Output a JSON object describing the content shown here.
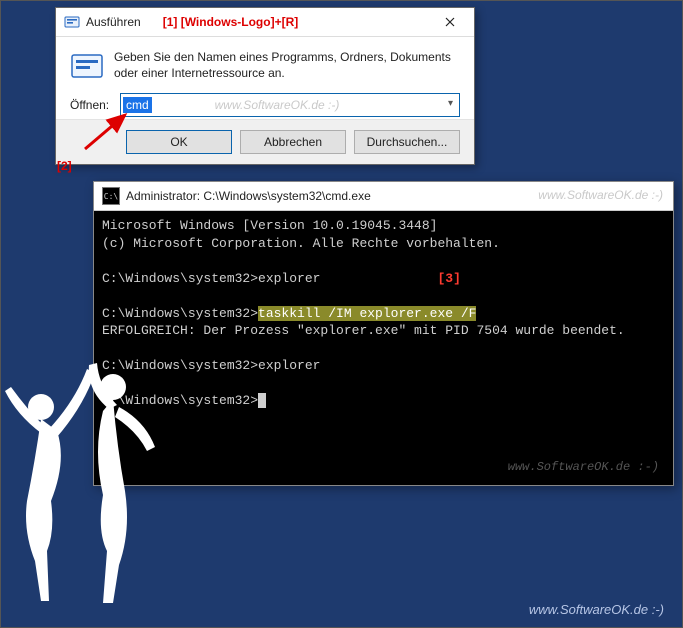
{
  "run": {
    "title": "Ausführen",
    "annot1": "[1] [Windows-Logo]+[R]",
    "description": "Geben Sie den Namen eines Programms, Ordners, Dokuments oder einer Internetressource an.",
    "open_label": "Öffnen:",
    "input_value": "cmd",
    "input_watermark": "www.SoftwareOK.de :-)",
    "ok": "OK",
    "cancel": "Abbrechen",
    "browse": "Durchsuchen...",
    "annot2": "[2]"
  },
  "cmd": {
    "title": "Administrator: C:\\Windows\\system32\\cmd.exe",
    "title_watermark": "www.SoftwareOK.de :-)",
    "line1": "Microsoft Windows [Version 10.0.19045.3448]",
    "line2": "(c) Microsoft Corporation. Alle Rechte vorbehalten.",
    "prompt": "C:\\Windows\\system32>",
    "cmd_explorer": "explorer",
    "annot3": "[3]",
    "cmd_taskkill": "taskkill /IM explorer.exe /F",
    "result": "ERFOLGREICH: Der Prozess \"explorer.exe\" mit PID 7504 wurde beendet.",
    "body_watermark": "www.SoftwareOK.de :-)"
  },
  "desktop_watermark": "www.SoftwareOK.de :-)"
}
